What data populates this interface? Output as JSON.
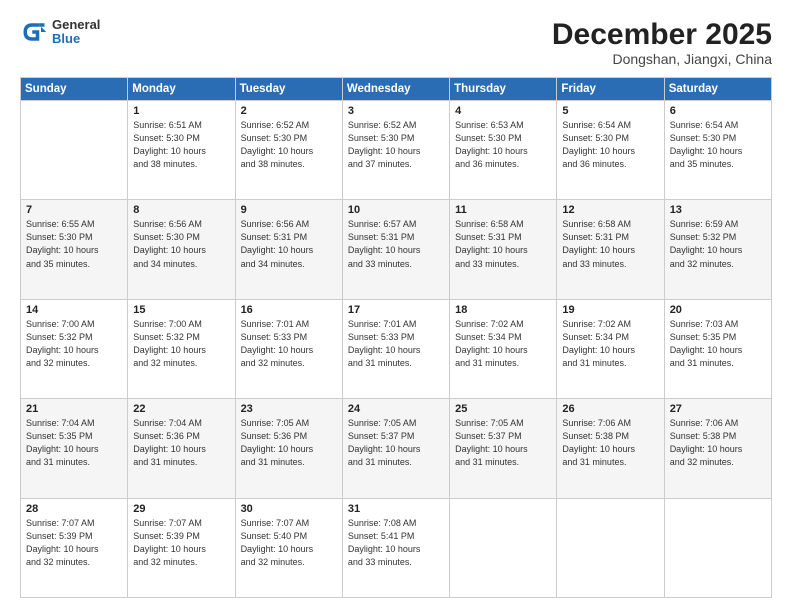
{
  "header": {
    "logo": {
      "general": "General",
      "blue": "Blue"
    },
    "title": "December 2025",
    "location": "Dongshan, Jiangxi, China"
  },
  "calendar": {
    "days_of_week": [
      "Sunday",
      "Monday",
      "Tuesday",
      "Wednesday",
      "Thursday",
      "Friday",
      "Saturday"
    ],
    "weeks": [
      [
        {
          "day": "",
          "info": ""
        },
        {
          "day": "1",
          "info": "Sunrise: 6:51 AM\nSunset: 5:30 PM\nDaylight: 10 hours\nand 38 minutes."
        },
        {
          "day": "2",
          "info": "Sunrise: 6:52 AM\nSunset: 5:30 PM\nDaylight: 10 hours\nand 38 minutes."
        },
        {
          "day": "3",
          "info": "Sunrise: 6:52 AM\nSunset: 5:30 PM\nDaylight: 10 hours\nand 37 minutes."
        },
        {
          "day": "4",
          "info": "Sunrise: 6:53 AM\nSunset: 5:30 PM\nDaylight: 10 hours\nand 36 minutes."
        },
        {
          "day": "5",
          "info": "Sunrise: 6:54 AM\nSunset: 5:30 PM\nDaylight: 10 hours\nand 36 minutes."
        },
        {
          "day": "6",
          "info": "Sunrise: 6:54 AM\nSunset: 5:30 PM\nDaylight: 10 hours\nand 35 minutes."
        }
      ],
      [
        {
          "day": "7",
          "info": "Sunrise: 6:55 AM\nSunset: 5:30 PM\nDaylight: 10 hours\nand 35 minutes."
        },
        {
          "day": "8",
          "info": "Sunrise: 6:56 AM\nSunset: 5:30 PM\nDaylight: 10 hours\nand 34 minutes."
        },
        {
          "day": "9",
          "info": "Sunrise: 6:56 AM\nSunset: 5:31 PM\nDaylight: 10 hours\nand 34 minutes."
        },
        {
          "day": "10",
          "info": "Sunrise: 6:57 AM\nSunset: 5:31 PM\nDaylight: 10 hours\nand 33 minutes."
        },
        {
          "day": "11",
          "info": "Sunrise: 6:58 AM\nSunset: 5:31 PM\nDaylight: 10 hours\nand 33 minutes."
        },
        {
          "day": "12",
          "info": "Sunrise: 6:58 AM\nSunset: 5:31 PM\nDaylight: 10 hours\nand 33 minutes."
        },
        {
          "day": "13",
          "info": "Sunrise: 6:59 AM\nSunset: 5:32 PM\nDaylight: 10 hours\nand 32 minutes."
        }
      ],
      [
        {
          "day": "14",
          "info": "Sunrise: 7:00 AM\nSunset: 5:32 PM\nDaylight: 10 hours\nand 32 minutes."
        },
        {
          "day": "15",
          "info": "Sunrise: 7:00 AM\nSunset: 5:32 PM\nDaylight: 10 hours\nand 32 minutes."
        },
        {
          "day": "16",
          "info": "Sunrise: 7:01 AM\nSunset: 5:33 PM\nDaylight: 10 hours\nand 32 minutes."
        },
        {
          "day": "17",
          "info": "Sunrise: 7:01 AM\nSunset: 5:33 PM\nDaylight: 10 hours\nand 31 minutes."
        },
        {
          "day": "18",
          "info": "Sunrise: 7:02 AM\nSunset: 5:34 PM\nDaylight: 10 hours\nand 31 minutes."
        },
        {
          "day": "19",
          "info": "Sunrise: 7:02 AM\nSunset: 5:34 PM\nDaylight: 10 hours\nand 31 minutes."
        },
        {
          "day": "20",
          "info": "Sunrise: 7:03 AM\nSunset: 5:35 PM\nDaylight: 10 hours\nand 31 minutes."
        }
      ],
      [
        {
          "day": "21",
          "info": "Sunrise: 7:04 AM\nSunset: 5:35 PM\nDaylight: 10 hours\nand 31 minutes."
        },
        {
          "day": "22",
          "info": "Sunrise: 7:04 AM\nSunset: 5:36 PM\nDaylight: 10 hours\nand 31 minutes."
        },
        {
          "day": "23",
          "info": "Sunrise: 7:05 AM\nSunset: 5:36 PM\nDaylight: 10 hours\nand 31 minutes."
        },
        {
          "day": "24",
          "info": "Sunrise: 7:05 AM\nSunset: 5:37 PM\nDaylight: 10 hours\nand 31 minutes."
        },
        {
          "day": "25",
          "info": "Sunrise: 7:05 AM\nSunset: 5:37 PM\nDaylight: 10 hours\nand 31 minutes."
        },
        {
          "day": "26",
          "info": "Sunrise: 7:06 AM\nSunset: 5:38 PM\nDaylight: 10 hours\nand 31 minutes."
        },
        {
          "day": "27",
          "info": "Sunrise: 7:06 AM\nSunset: 5:38 PM\nDaylight: 10 hours\nand 32 minutes."
        }
      ],
      [
        {
          "day": "28",
          "info": "Sunrise: 7:07 AM\nSunset: 5:39 PM\nDaylight: 10 hours\nand 32 minutes."
        },
        {
          "day": "29",
          "info": "Sunrise: 7:07 AM\nSunset: 5:39 PM\nDaylight: 10 hours\nand 32 minutes."
        },
        {
          "day": "30",
          "info": "Sunrise: 7:07 AM\nSunset: 5:40 PM\nDaylight: 10 hours\nand 32 minutes."
        },
        {
          "day": "31",
          "info": "Sunrise: 7:08 AM\nSunset: 5:41 PM\nDaylight: 10 hours\nand 33 minutes."
        },
        {
          "day": "",
          "info": ""
        },
        {
          "day": "",
          "info": ""
        },
        {
          "day": "",
          "info": ""
        }
      ]
    ]
  }
}
